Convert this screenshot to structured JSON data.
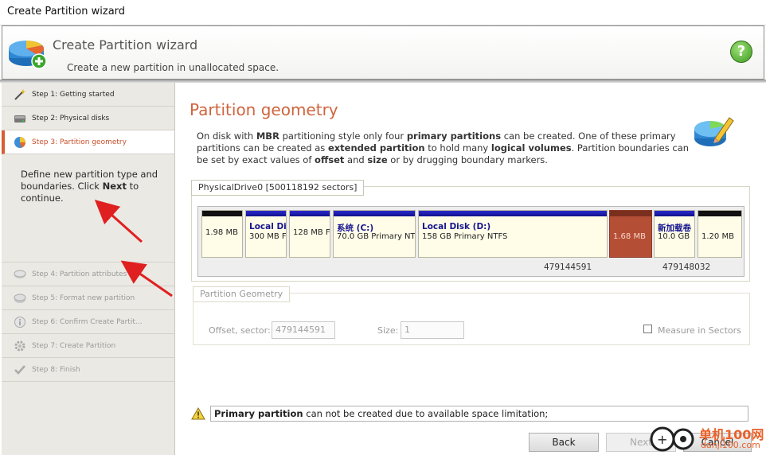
{
  "window": {
    "title": "Create Partition wizard"
  },
  "header": {
    "title": "Create Partition wizard",
    "subtitle": "Create a new partition in unallocated space.",
    "help_label": "?"
  },
  "sidebar": {
    "steps": [
      {
        "label": "Step 1: Getting started",
        "icon": "wand-icon",
        "state": "done"
      },
      {
        "label": "Step 2: Physical disks",
        "icon": "hard-disk-icon",
        "state": "done"
      },
      {
        "label": "Step 3: Partition geometry",
        "icon": "partition-icon",
        "state": "active"
      },
      {
        "label": "Step 4: Partition attributes",
        "icon": "attributes-icon",
        "state": "disabled"
      },
      {
        "label": "Step 5: Format new partition",
        "icon": "format-icon",
        "state": "disabled"
      },
      {
        "label": "Step 6: Confirm Create Partit...",
        "icon": "info-icon",
        "state": "disabled"
      },
      {
        "label": "Step 7: Create Partition",
        "icon": "gear-icon",
        "state": "disabled"
      },
      {
        "label": "Step 8: Finish",
        "icon": "check-icon",
        "state": "disabled"
      }
    ],
    "description_pre": "Define new partition type and boundaries. Click ",
    "description_bold": "Next",
    "description_post": " to continue."
  },
  "main": {
    "title": "Partition geometry",
    "desc": {
      "t1": "On disk with ",
      "b1": "MBR",
      "t2": " partitioning style only four ",
      "b2": "primary partitions",
      "t3": " can be created. One of these primary partitions can be created as ",
      "b3": "extended partition",
      "t4": " to hold many ",
      "b4": "logical volumes",
      "t5": ". Partition boundaries can be set by exact values of ",
      "b5": "offset",
      "t6": " and ",
      "b6": "size",
      "t7": " or by drugging boundary markers."
    }
  },
  "disk": {
    "label": "PhysicalDrive0 [500118192 sectors]",
    "partitions": [
      {
        "name": "",
        "info": "1.98 MB",
        "cap": "black"
      },
      {
        "name": "Local Dis",
        "info": "300 MB F",
        "cap": "blue"
      },
      {
        "name": "",
        "info": "128 MB F",
        "cap": "blue"
      },
      {
        "name": "系统 (C:)",
        "info": "70.0 GB Primary NT",
        "cap": "blue"
      },
      {
        "name": "Local Disk (D:)",
        "info": "158 GB Primary NTFS",
        "cap": "blue"
      },
      {
        "name": "",
        "info": "1.68 MB",
        "cap": "selected"
      },
      {
        "name": "新加载卷",
        "info": "10.0 GB",
        "cap": "blue"
      },
      {
        "name": "",
        "info": "1.20 MB",
        "cap": "black"
      }
    ],
    "sector_start": "479144591",
    "sector_end": "479148032"
  },
  "geometry": {
    "legend": "Partition Geometry",
    "offset_label": "Offset, sector:",
    "offset_value": "479144591",
    "size_label": "Size:",
    "size_value": "1",
    "measure_label": "Measure in Sectors"
  },
  "status": {
    "bold": "Primary partition",
    "text": " can not be created due to available space limitation;"
  },
  "buttons": {
    "back": "Back",
    "next": "Next",
    "cancel": "Cancel"
  },
  "watermark": {
    "line1": "单机100网",
    "line2": "danji100.com"
  },
  "colors": {
    "accent": "#d0643e",
    "active_step": "#c9502b",
    "partition_blue": "#15158f",
    "selected_partition": "#b44f36",
    "annotation_arrow": "#e02020"
  }
}
